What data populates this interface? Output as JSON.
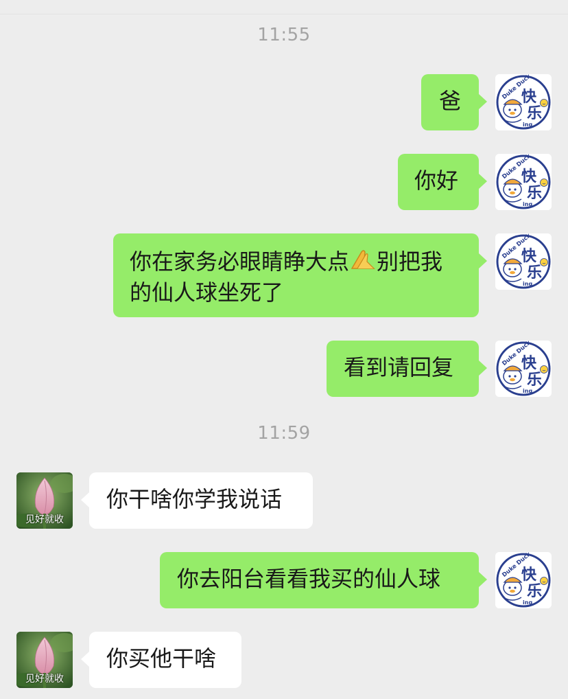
{
  "timestamps": [
    "11:55",
    "11:59"
  ],
  "messages": [
    {
      "side": "out",
      "text": "爸"
    },
    {
      "side": "out",
      "text": "你好"
    },
    {
      "side": "out",
      "line1": "你在家务必眼睛睁大点",
      "emoji": "praying-hands",
      "line1b": "别把我",
      "line2": "的仙人球坐死了"
    },
    {
      "side": "out",
      "text": "看到请回复"
    },
    {
      "side": "in",
      "text": "你干啥你学我说话"
    },
    {
      "side": "out",
      "text": "你去阳台看看我买的仙人球"
    },
    {
      "side": "in",
      "text": "你买他干啥"
    }
  ],
  "self_avatar": {
    "icon": "duck-avatar-icon",
    "script": "Duke Duck",
    "big": "快乐",
    "small": "ing"
  },
  "peer_avatar": {
    "icon": "lotus-bud-avatar-icon",
    "caption": "见好就收"
  },
  "colors": {
    "outgoing": "#95ec69",
    "incoming": "#ffffff",
    "background": "#ededed",
    "timestamp": "#a3a3a3"
  }
}
